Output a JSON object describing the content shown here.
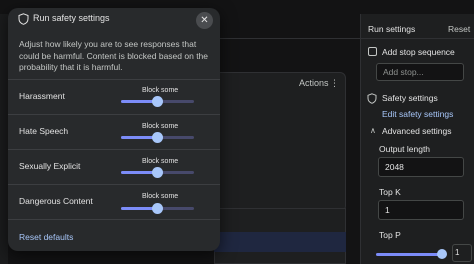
{
  "background": {
    "actions_label": "Actions",
    "kebab": "⋮"
  },
  "run_settings": {
    "title": "Run settings",
    "reset_label": "Reset",
    "add_stop_sequence_label": "Add stop sequence",
    "stop_placeholder": "Add stop...",
    "safety_settings_label": "Safety settings",
    "edit_safety_label": "Edit safety settings",
    "advanced_settings_label": "Advanced settings",
    "output_length_label": "Output length",
    "output_length_value": "2048",
    "top_k_label": "Top K",
    "top_k_value": "1",
    "top_p_label": "Top P",
    "top_p_value": "1"
  },
  "modal": {
    "title": "Run safety settings",
    "description": "Adjust how likely you are to see responses that could be harmful. Content is blocked based on the probability that it is harmful.",
    "reset_defaults_label": "Reset defaults",
    "categories": [
      {
        "label": "Harassment",
        "level": "Block some",
        "value": 0.5
      },
      {
        "label": "Hate Speech",
        "level": "Block some",
        "value": 0.5
      },
      {
        "label": "Sexually Explicit",
        "level": "Block some",
        "value": 0.5
      },
      {
        "label": "Dangerous Content",
        "level": "Block some",
        "value": 0.5
      }
    ]
  },
  "colors": {
    "accent": "#a8c7fa",
    "slider_fill": "#7c8cf8",
    "modal_bg": "#282a2c",
    "panel_bg": "#1e1f20"
  }
}
